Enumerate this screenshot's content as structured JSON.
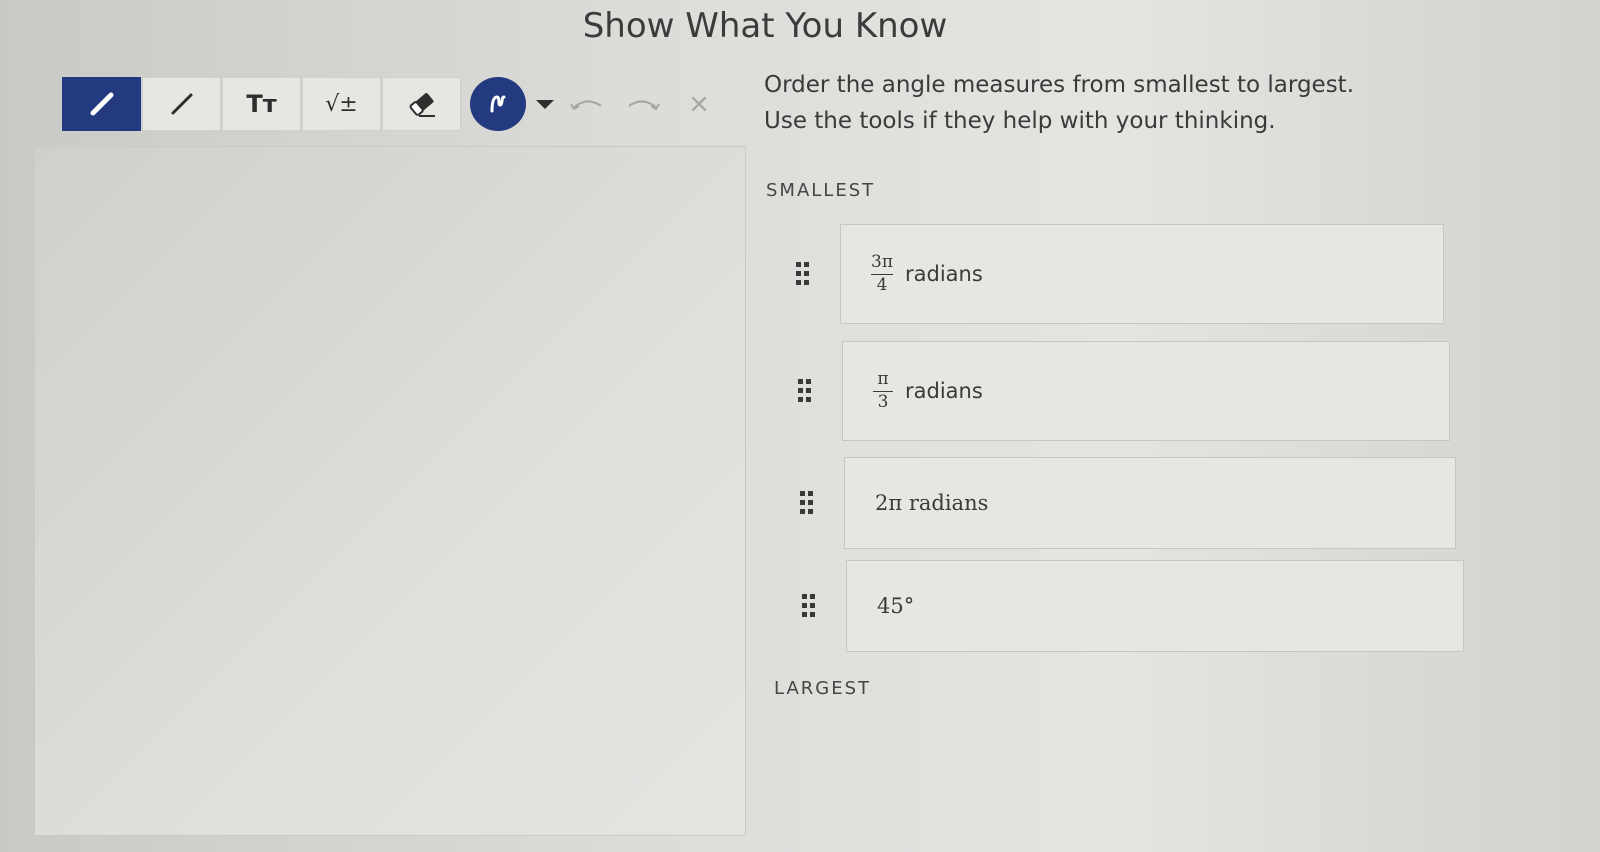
{
  "page": {
    "title": "Show What You Know"
  },
  "toolbar": {
    "tools": [
      {
        "name": "pen-tool",
        "icon": "pencil-icon",
        "active": true
      },
      {
        "name": "line-tool",
        "icon": "line-icon"
      },
      {
        "name": "text-tool",
        "icon": "text-size-icon",
        "label": "Tт"
      },
      {
        "name": "math-tool",
        "icon": "square-root-icon",
        "label": "√±"
      },
      {
        "name": "eraser-tool",
        "icon": "eraser-icon"
      }
    ],
    "color_picker": {
      "icon": "color-swatch-icon",
      "color": "#243a80"
    },
    "undo_icon": "undo-icon",
    "redo_icon": "redo-icon",
    "clear_icon": "close-icon",
    "clear_label": "×"
  },
  "instructions": {
    "line1": "Order the angle measures from smallest to largest.",
    "line2": "Use the tools if they help with your thinking."
  },
  "ordering": {
    "smallest_label": "SMALLEST",
    "largest_label": "LARGEST",
    "items": [
      {
        "kind": "fraction",
        "numerator": "3π",
        "denominator": "4",
        "unit": "radians"
      },
      {
        "kind": "fraction",
        "numerator": "π",
        "denominator": "3",
        "unit": "radians"
      },
      {
        "kind": "plain",
        "text": "2π radians"
      },
      {
        "kind": "degree",
        "text": "45°"
      }
    ]
  },
  "colors": {
    "accent": "#243a80"
  }
}
